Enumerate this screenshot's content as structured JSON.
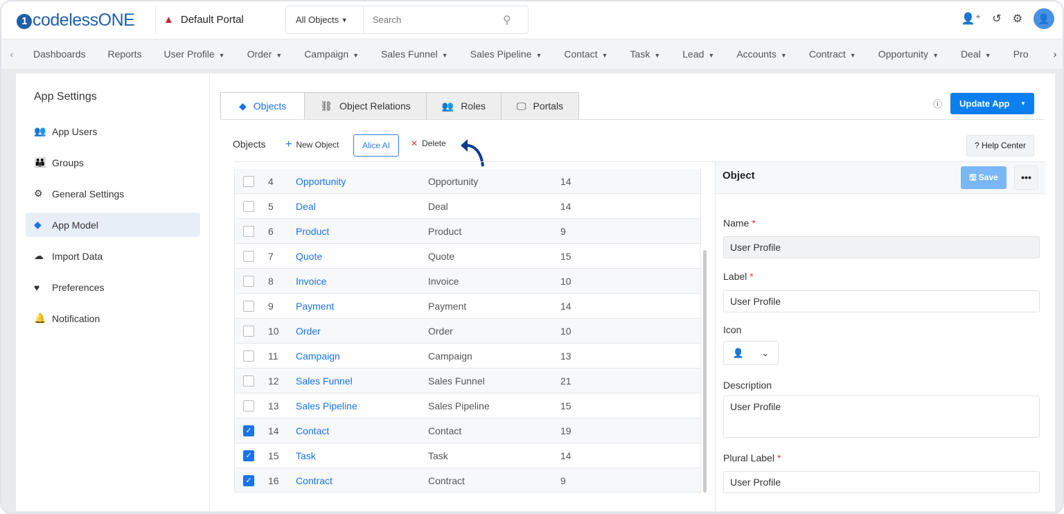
{
  "header": {
    "logo": "codelessONE",
    "portal": "Default Portal",
    "search_scope": "All Objects",
    "search_placeholder": "Search"
  },
  "nav": {
    "items": [
      {
        "label": "Dashboards",
        "dropdown": false
      },
      {
        "label": "Reports",
        "dropdown": false
      },
      {
        "label": "User Profile",
        "dropdown": true
      },
      {
        "label": "Order",
        "dropdown": true
      },
      {
        "label": "Campaign",
        "dropdown": true
      },
      {
        "label": "Sales Funnel",
        "dropdown": true
      },
      {
        "label": "Sales Pipeline",
        "dropdown": true
      },
      {
        "label": "Contact",
        "dropdown": true
      },
      {
        "label": "Task",
        "dropdown": true
      },
      {
        "label": "Lead",
        "dropdown": true
      },
      {
        "label": "Accounts",
        "dropdown": true
      },
      {
        "label": "Contract",
        "dropdown": true
      },
      {
        "label": "Opportunity",
        "dropdown": true
      },
      {
        "label": "Deal",
        "dropdown": true
      },
      {
        "label": "Pro",
        "dropdown": false
      }
    ]
  },
  "sidebar": {
    "title": "App Settings",
    "items": [
      {
        "label": "App Users",
        "icon": "users-icon"
      },
      {
        "label": "Groups",
        "icon": "group-icon"
      },
      {
        "label": "General Settings",
        "icon": "gear-icon"
      },
      {
        "label": "App Model",
        "icon": "cube-icon",
        "active": true
      },
      {
        "label": "Import Data",
        "icon": "cloud-upload-icon"
      },
      {
        "label": "Preferences",
        "icon": "hand-heart-icon"
      },
      {
        "label": "Notification",
        "icon": "bell-icon"
      }
    ]
  },
  "tabs": [
    {
      "label": "Objects",
      "active": true
    },
    {
      "label": "Object Relations"
    },
    {
      "label": "Roles"
    },
    {
      "label": "Portals"
    }
  ],
  "update_app": "Update App",
  "toolbar": {
    "title": "Objects",
    "new_object": "New Object",
    "alice_ai": "Alice AI",
    "delete": "Delete",
    "help_center": "Help Center"
  },
  "rows": [
    {
      "n": "4",
      "name": "Opportunity",
      "label": "Opportunity",
      "count": "14",
      "checked": false
    },
    {
      "n": "5",
      "name": "Deal",
      "label": "Deal",
      "count": "14",
      "checked": false
    },
    {
      "n": "6",
      "name": "Product",
      "label": "Product",
      "count": "9",
      "checked": false
    },
    {
      "n": "7",
      "name": "Quote",
      "label": "Quote",
      "count": "15",
      "checked": false
    },
    {
      "n": "8",
      "name": "Invoice",
      "label": "Invoice",
      "count": "10",
      "checked": false
    },
    {
      "n": "9",
      "name": "Payment",
      "label": "Payment",
      "count": "14",
      "checked": false
    },
    {
      "n": "10",
      "name": "Order",
      "label": "Order",
      "count": "10",
      "checked": false
    },
    {
      "n": "11",
      "name": "Campaign",
      "label": "Campaign",
      "count": "13",
      "checked": false
    },
    {
      "n": "12",
      "name": "Sales Funnel",
      "label": "Sales Funnel",
      "count": "21",
      "checked": false
    },
    {
      "n": "13",
      "name": "Sales Pipeline",
      "label": "Sales Pipeline",
      "count": "15",
      "checked": false
    },
    {
      "n": "14",
      "name": "Contact",
      "label": "Contact",
      "count": "19",
      "checked": true
    },
    {
      "n": "15",
      "name": "Task",
      "label": "Task",
      "count": "14",
      "checked": true
    },
    {
      "n": "16",
      "name": "Contract",
      "label": "Contract",
      "count": "9",
      "checked": true
    }
  ],
  "panel": {
    "title": "Object",
    "save": "Save",
    "name_label": "Name",
    "name_value": "User Profile",
    "label_label": "Label",
    "label_value": "User Profile",
    "icon_label": "Icon",
    "description_label": "Description",
    "description_value": "User Profile",
    "plural_label": "Plural Label",
    "plural_value": "User Profile"
  }
}
